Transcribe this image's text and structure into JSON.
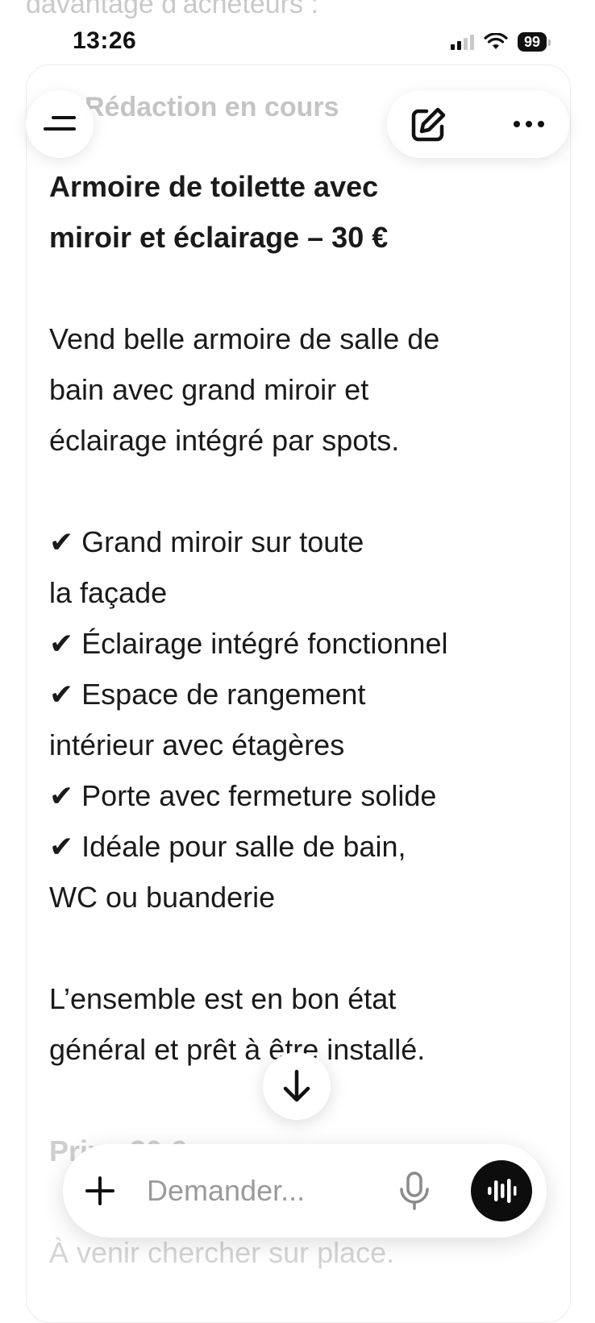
{
  "status_bar": {
    "time": "13:26",
    "battery": "99"
  },
  "top_faded_text": "davantage d’acheteurs :",
  "header": {
    "title": "Rédaction en cours"
  },
  "message": {
    "title_line1": "Armoire de toilette avec",
    "title_line2": "miroir et éclairage – 30 €",
    "intro": [
      "Vend belle armoire de salle de",
      "bain avec grand miroir et",
      "éclairage intégré par spots."
    ],
    "check_mark": "✔",
    "features": [
      [
        "Grand miroir sur toute",
        "la façade"
      ],
      [
        "Éclairage intégré fonctionnel"
      ],
      [
        "Espace de rangement",
        "intérieur avec étagères"
      ],
      [
        "Porte avec fermeture solide"
      ],
      [
        "Idéale pour salle de bain,",
        "WC ou buanderie"
      ]
    ],
    "summary": [
      "L’ensemble est en bon état",
      "général et prêt à être installé."
    ],
    "price_line": "Prix : 30 €",
    "pickup_line": "À venir chercher sur place."
  },
  "composer": {
    "placeholder": "Demander..."
  },
  "icons": {
    "menu": "menu-icon",
    "edit": "edit-icon",
    "more": "more-icon",
    "scroll_down": "arrow-down-icon",
    "plus": "plus-icon",
    "mic": "microphone-icon",
    "voice": "voice-mode-icon"
  }
}
